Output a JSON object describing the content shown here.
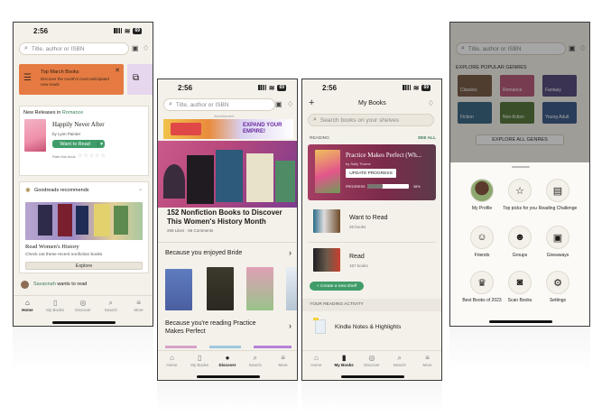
{
  "status": {
    "time": "2:56",
    "battery": "69"
  },
  "tabs": [
    "Home",
    "My Books",
    "Discover",
    "Search",
    "More"
  ],
  "screen1": {
    "search_placeholder": "Title, author or ISBN",
    "banner_title": "Top March Books",
    "banner_text": "Discover the month's most anticipated new reads",
    "new_releases": "New Releases in",
    "genre": "Romance",
    "book_title": "Happily Never After",
    "book_author": "by Lynn Painter",
    "want_to_read": "Want to Read",
    "rate_this": "Rate this book",
    "recommends": "Goodreads recommends",
    "read_womens": "Read Women's History",
    "read_womens_sub": "Check out these recent nonfiction books",
    "explore": "Explore",
    "friend_name": "Savannah",
    "friend_action": "wants to read"
  },
  "screen2": {
    "search_placeholder": "Title, author or ISBN",
    "ad_label": "Advertisement",
    "ad_title": "EXPAND YOUR EMPIRE!",
    "hero_title": "152 Nonfiction Books to Discover This Women's History Month",
    "hero_meta": "269 Likes · 56 Comments",
    "because_bride": "Because you enjoyed Bride",
    "because_practice": "Because you're reading Practice Makes Perfect"
  },
  "screen3": {
    "title": "My Books",
    "search_placeholder": "Search books on your shelves",
    "reading_label": "READING",
    "see_all": "SEE ALL",
    "current_title": "Practice Makes Perfect (Wh...",
    "current_author": "by Sally Thorne",
    "update_progress": "UPDATE PROGRESS",
    "progress_label": "PROGRESS",
    "progress_pct": "38%",
    "progress_value": 0.38,
    "shelves": [
      {
        "name": "Want to Read",
        "count": "26 books"
      },
      {
        "name": "Read",
        "count": "167 books"
      }
    ],
    "create_shelf": "+ Create a new shelf",
    "activity_label": "YOUR READING ACTIVITY",
    "kindle": "Kindle Notes & Highlights"
  },
  "screen4": {
    "search_placeholder": "Title, author or ISBN",
    "explore_label": "EXPLORE POPULAR GENRES",
    "genres": [
      "Classics",
      "Romance",
      "Fantasy",
      "Fiction",
      "Non-fiction",
      "Young Adult"
    ],
    "explore_all": "EXPLORE ALL GENRES",
    "menu": [
      "My Profile",
      "Top picks for you",
      "Reading Challenge",
      "Friends",
      "Groups",
      "Giveaways",
      "Best Books of 2023",
      "Scan Books",
      "Settings"
    ]
  }
}
